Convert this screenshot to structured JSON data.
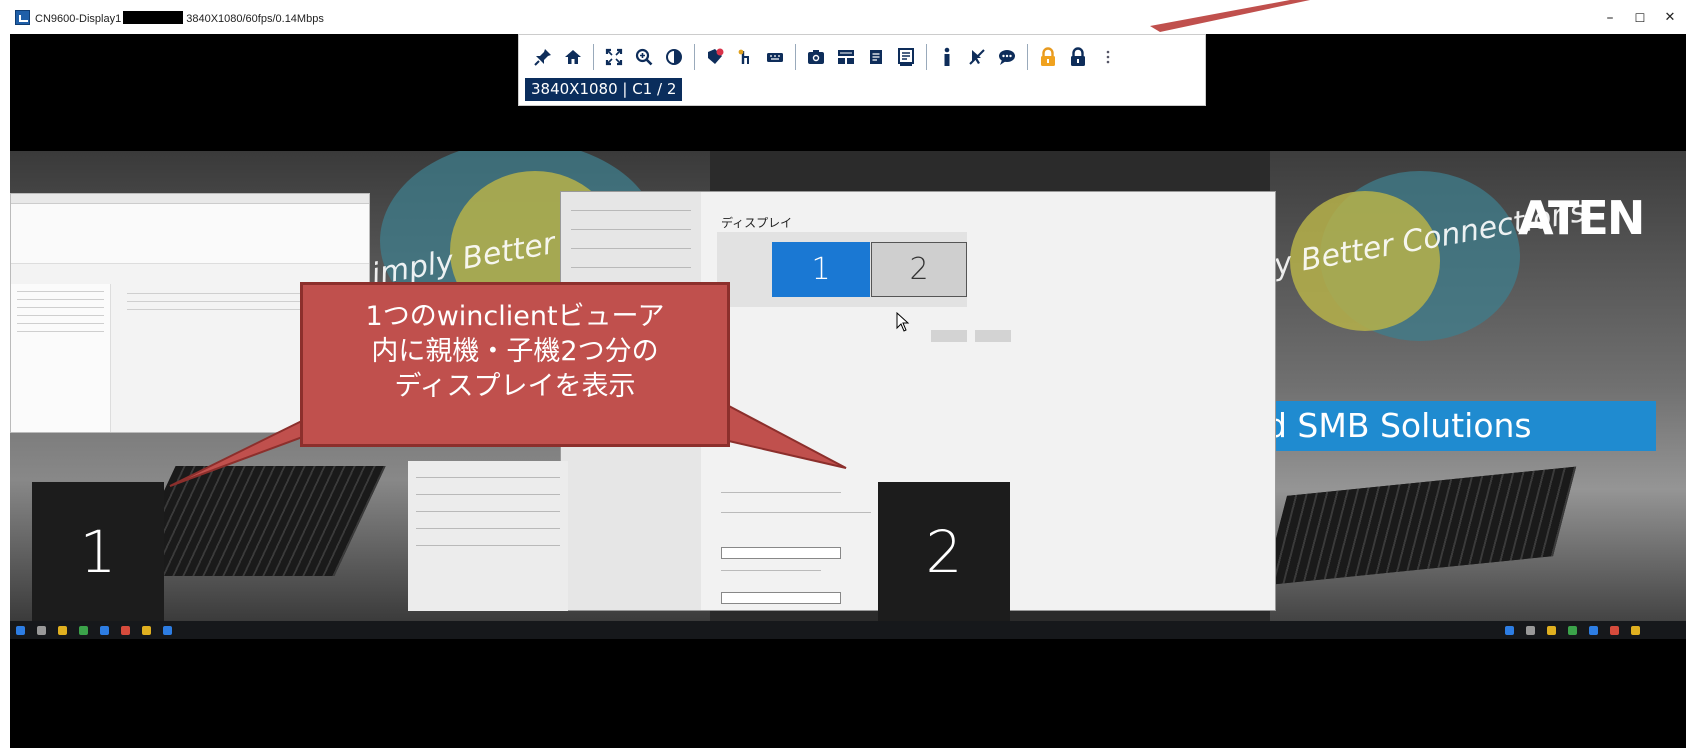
{
  "titlebar": {
    "app_name": "CN9600-Display1",
    "stream_info": "3840X1080/60fps/0.14Mbps",
    "minimize_label": "–",
    "maximize_label": "☐",
    "close_label": "✕"
  },
  "toolbar": {
    "icons": [
      "pin-icon",
      "home-icon",
      "fullscreen-icon",
      "zoom-icon",
      "contrast-icon",
      "tag-icon",
      "pointer-icon",
      "keyboard-icon",
      "camera-icon",
      "layout-icon",
      "document-icon",
      "presentation-icon",
      "info-icon",
      "no-pointer-icon",
      "chat-icon",
      "lock-orange-icon",
      "lock-dark-icon",
      "more-icon"
    ],
    "resolution_label": "3840X1080 | C1 / 2"
  },
  "remote": {
    "screen1_number": "1",
    "screen2_number": "2",
    "settings_title": "ディスプレイ",
    "monitor1": "1",
    "monitor2": "2",
    "brand_text_left": "imply Better Con",
    "brand_text_right": "y Better Connections",
    "aten_logo": "ATEN",
    "smb_text": "d SMB Solutions"
  },
  "callout": {
    "line1": "1つのwinclientビューア",
    "line2": "内に親機・子機2つ分の",
    "line3": "ディスプレイを表示"
  },
  "colors": {
    "callout_fill": "#c0504d",
    "resolution_badge": "#0a2d5c",
    "primary_monitor": "#1a78d3",
    "smb_bar": "#1f8bd0"
  }
}
